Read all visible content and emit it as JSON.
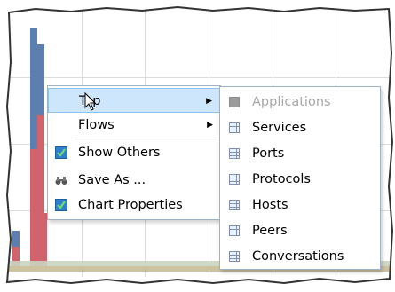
{
  "context_menu": {
    "items": [
      {
        "label": "Top",
        "has_submenu": true,
        "icon": "",
        "highlighted": true
      },
      {
        "label": "Flows",
        "has_submenu": true,
        "icon": ""
      },
      {
        "label": "Show Others",
        "has_submenu": false,
        "icon": "checkbox-checked-icon"
      },
      {
        "label": "Save As ...",
        "has_submenu": false,
        "icon": "binoculars-icon"
      },
      {
        "label": "Chart Properties",
        "has_submenu": false,
        "icon": "chart-checked-icon"
      }
    ]
  },
  "submenu": {
    "items": [
      {
        "label": "Applications",
        "disabled": true,
        "icon": "grid-icon"
      },
      {
        "label": "Services",
        "disabled": false,
        "icon": "grid-icon"
      },
      {
        "label": "Ports",
        "disabled": false,
        "icon": "grid-icon"
      },
      {
        "label": "Protocols",
        "disabled": false,
        "icon": "grid-icon"
      },
      {
        "label": "Hosts",
        "disabled": false,
        "icon": "grid-icon"
      },
      {
        "label": "Peers",
        "disabled": false,
        "icon": "grid-icon"
      },
      {
        "label": "Conversations",
        "disabled": false,
        "icon": "grid-icon"
      }
    ]
  },
  "colors": {
    "blue_series": "#5b7fb0",
    "red_series": "#d2626b",
    "highlight": "#cde6fb",
    "menu_border": "#9fb3c8"
  }
}
